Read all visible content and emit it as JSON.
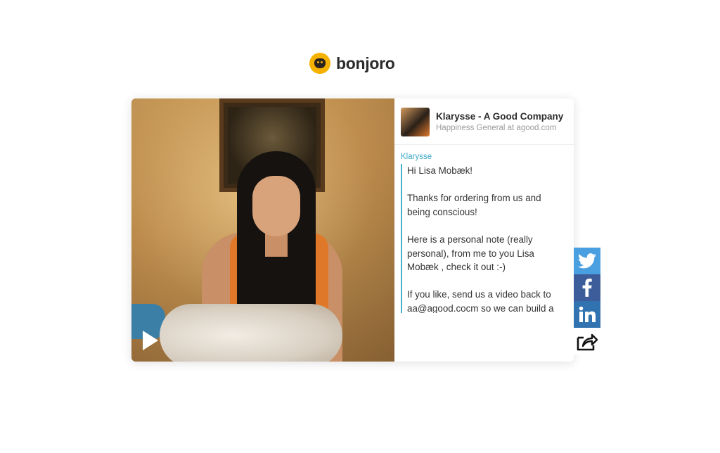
{
  "brand": {
    "name": "bonjoro",
    "logo_icon": "bonjoro-dog-icon",
    "accent": "#f5b200"
  },
  "video": {
    "play_icon": "play-icon"
  },
  "sender": {
    "name": "Klarysse - A Good Company",
    "role": "Happiness General at agood.com"
  },
  "message": {
    "author": "Klarysse",
    "paragraphs": [
      "Hi Lisa Mobæk!",
      "Thanks for ordering from us and being conscious!",
      "Here is a personal note (really personal), from me to you Lisa Mobæk , check it out :-)",
      "If you like, send us a video back to aa@agood.cocm so we can build a"
    ],
    "accent": "#45b1cf"
  },
  "share": {
    "twitter_icon": "twitter-icon",
    "facebook_icon": "facebook-icon",
    "linkedin_icon": "linkedin-icon",
    "share_icon": "share-icon",
    "colors": {
      "twitter": "#4a9fe0",
      "facebook": "#3c5d9a",
      "linkedin": "#3173b0"
    }
  }
}
